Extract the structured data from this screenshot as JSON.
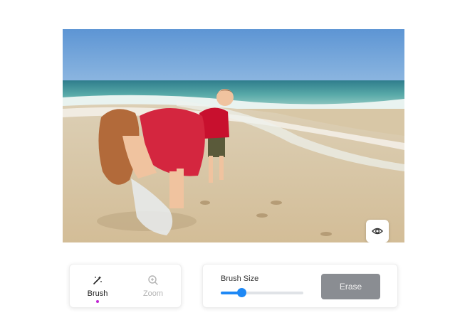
{
  "editor": {
    "photo_description_icon": "beach-photo",
    "preview_icon": "eye-icon"
  },
  "tools": {
    "items": [
      {
        "label": "Brush",
        "icon": "magic-brush-icon",
        "active": true
      },
      {
        "label": "Zoom",
        "icon": "zoom-in-icon",
        "active": false
      }
    ],
    "active_indicator_color": "#c026d3"
  },
  "settings": {
    "brush_size_label": "Brush Size",
    "brush_size_value": 0.25,
    "erase_label": "Erase"
  },
  "colors": {
    "accent": "#1e88f5",
    "erase_button": "#8a8d92"
  }
}
